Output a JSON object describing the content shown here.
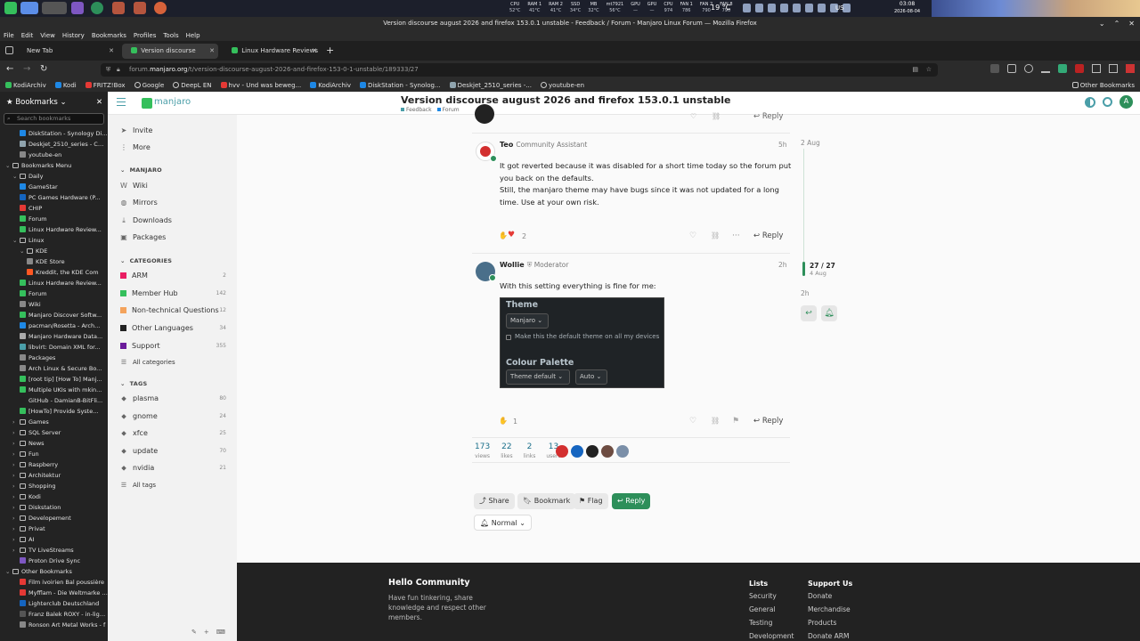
{
  "taskbar": {
    "stats": [
      {
        "label": "CPU",
        "value": "52°C"
      },
      {
        "label": "RAM 1",
        "value": "41°C"
      },
      {
        "label": "RAM 2",
        "value": "41°C"
      },
      {
        "label": "SSD",
        "value": "34°C"
      },
      {
        "label": "MB",
        "value": "32°C"
      },
      {
        "label": "mt7921",
        "value": "56°C"
      },
      {
        "label": "GPU",
        "value": "—"
      },
      {
        "label": "GPU",
        "value": "—"
      },
      {
        "label": "CPU",
        "value": "974"
      },
      {
        "label": "FAN 1",
        "value": "786"
      },
      {
        "label": "FAN 2",
        "value": "790"
      },
      {
        "label": "FAN 8",
        "value": "790"
      }
    ],
    "weather": "19 °C",
    "lang": "US",
    "time": "03:08",
    "date": "2026-08-04"
  },
  "window": {
    "title": "Version discourse august 2026 and firefox 153.0.1 unstable - Feedback / Forum - Manjaro Linux Forum — Mozilla Firefox"
  },
  "menu": [
    "File",
    "Edit",
    "View",
    "History",
    "Bookmarks",
    "Profiles",
    "Tools",
    "Help"
  ],
  "tabs": [
    {
      "label": "New Tab"
    },
    {
      "label": "Version discourse august 2"
    },
    {
      "label": "Linux Hardware Reviews &"
    }
  ],
  "url": {
    "pre": "forum.",
    "domain": "manjaro.org",
    "path": "/t/version-discourse-august-2026-and-firefox-153-0-1-unstable/189333/27"
  },
  "bookmarks_toolbar": {
    "items": [
      "KodiArchiv",
      "Kodi",
      "FRITZ!Box",
      "Google",
      "DeepL EN",
      "hvv - Und was beweg...",
      "KodiArchiv",
      "DiskStation - Synolog...",
      "Deskjet_2510_series -...",
      "youtube-en"
    ],
    "other": "Other Bookmarks"
  },
  "bm_sidebar": {
    "title": "Bookmarks",
    "search_placeholder": "Search bookmarks",
    "rows": [
      {
        "indent": 2,
        "type": "link",
        "label": "DiskStation - Synology Dis...",
        "color": "#1e88e5"
      },
      {
        "indent": 2,
        "type": "link",
        "label": "Deskjet_2510_series - CUP...",
        "color": "#90a4ae"
      },
      {
        "indent": 2,
        "type": "link",
        "label": "youtube-en",
        "color": "#888888"
      },
      {
        "indent": 0,
        "type": "folder",
        "label": "Bookmarks Menu"
      },
      {
        "indent": 1,
        "type": "folder",
        "label": "Daily"
      },
      {
        "indent": 2,
        "type": "link",
        "label": "GameStar",
        "color": "#1e88e5"
      },
      {
        "indent": 2,
        "type": "link",
        "label": "PC Games Hardware (P...",
        "color": "#1565c0"
      },
      {
        "indent": 2,
        "type": "link",
        "label": "CHIP",
        "color": "#e53935"
      },
      {
        "indent": 2,
        "type": "link",
        "label": "Forum",
        "color": "#35bf5c"
      },
      {
        "indent": 2,
        "type": "link",
        "label": "Linux Hardware Review...",
        "color": "#35bf5c"
      },
      {
        "indent": 1,
        "type": "folder",
        "label": "Linux"
      },
      {
        "indent": 2,
        "type": "folder",
        "label": "KDE"
      },
      {
        "indent": 3,
        "type": "link",
        "label": "KDE Store",
        "color": "#888888"
      },
      {
        "indent": 3,
        "type": "link",
        "label": "Kreddit, the KDE Com",
        "color": "#ff5722"
      },
      {
        "indent": 2,
        "type": "link",
        "label": "Linux Hardware Review...",
        "color": "#35bf5c"
      },
      {
        "indent": 2,
        "type": "link",
        "label": "Forum",
        "color": "#35bf5c"
      },
      {
        "indent": 2,
        "type": "link",
        "label": "Wiki",
        "color": "#888888"
      },
      {
        "indent": 2,
        "type": "link",
        "label": "Manjaro Discover Softw...",
        "color": "#35bf5c"
      },
      {
        "indent": 2,
        "type": "link",
        "label": "pacman/Rosetta - Arch...",
        "color": "#1e88e5"
      },
      {
        "indent": 2,
        "type": "link",
        "label": "Manjaro Hardware Data...",
        "color": "#aaaaaa"
      },
      {
        "indent": 2,
        "type": "link",
        "label": "libvirt: Domain XML for...",
        "color": "#4a9ea8"
      },
      {
        "indent": 2,
        "type": "link",
        "label": "Packages",
        "color": "#888888"
      },
      {
        "indent": 2,
        "type": "link",
        "label": "Arch Linux & Secure Bo...",
        "color": "#888888"
      },
      {
        "indent": 2,
        "type": "link",
        "label": "[root tip] [How To] Manj...",
        "color": "#35bf5c"
      },
      {
        "indent": 2,
        "type": "link",
        "label": "Multiple UKIs with mkin...",
        "color": "#35bf5c"
      },
      {
        "indent": 2,
        "type": "link",
        "label": "GitHub - DamianB-BitFli...",
        "color": "#222222"
      },
      {
        "indent": 2,
        "type": "link",
        "label": "[HowTo] Provide Syste...",
        "color": "#35bf5c"
      },
      {
        "indent": 1,
        "type": "folder-closed",
        "label": "Games"
      },
      {
        "indent": 1,
        "type": "folder-closed",
        "label": "SQL Server"
      },
      {
        "indent": 1,
        "type": "folder-closed",
        "label": "News"
      },
      {
        "indent": 1,
        "type": "folder-closed",
        "label": "Fun"
      },
      {
        "indent": 1,
        "type": "folder-closed",
        "label": "Raspberry"
      },
      {
        "indent": 1,
        "type": "folder-closed",
        "label": "Architektur"
      },
      {
        "indent": 1,
        "type": "folder-closed",
        "label": "Shopping"
      },
      {
        "indent": 1,
        "type": "folder-closed",
        "label": "Kodi"
      },
      {
        "indent": 1,
        "type": "folder-closed",
        "label": "Diskstation"
      },
      {
        "indent": 1,
        "type": "folder-closed",
        "label": "Developement"
      },
      {
        "indent": 1,
        "type": "folder-closed",
        "label": "Privat"
      },
      {
        "indent": 1,
        "type": "folder-closed",
        "label": "AI"
      },
      {
        "indent": 1,
        "type": "folder-closed",
        "label": "TV LiveStreams"
      },
      {
        "indent": 2,
        "type": "link",
        "label": "Proton Drive Sync",
        "color": "#7e57c2"
      },
      {
        "indent": 0,
        "type": "folder",
        "label": "Other Bookmarks"
      },
      {
        "indent": 2,
        "type": "link",
        "label": "Film ivoirien Bal poussière",
        "color": "#e53935"
      },
      {
        "indent": 2,
        "type": "link",
        "label": "Myfflam - Die Weltmarke f...",
        "color": "#e53935"
      },
      {
        "indent": 2,
        "type": "link",
        "label": "Lighterclub Deutschland",
        "color": "#1565c0"
      },
      {
        "indent": 2,
        "type": "link",
        "label": "Franz Balek ROXY - in-light...",
        "color": "#555555"
      },
      {
        "indent": 2,
        "type": "link",
        "label": "Ronson Art Metal Works - f",
        "color": "#888888"
      }
    ]
  },
  "discourse_header": {
    "logo": "manjaro",
    "title": "Version discourse august 2026 and firefox 153.0.1 unstable",
    "breadcrumb": [
      "Feedback",
      "Forum"
    ]
  },
  "discourse_sidebar": {
    "top_items": [
      "Invite",
      "More"
    ],
    "manjaro_section": "MANJARO",
    "manjaro_items": [
      "Wiki",
      "Mirrors",
      "Downloads",
      "Packages"
    ],
    "categories_section": "CATEGORIES",
    "categories": [
      {
        "label": "ARM",
        "count": "2",
        "color": "#e91e63"
      },
      {
        "label": "Member Hub",
        "count": "142",
        "color": "#35bf5c"
      },
      {
        "label": "Non-technical Questions",
        "count": "12",
        "color": "#f4a35c"
      },
      {
        "label": "Other Languages",
        "count": "34",
        "color": "#222222"
      },
      {
        "label": "Support",
        "count": "355",
        "color": "#6a1b9a"
      }
    ],
    "all_categories": "All categories",
    "tags_section": "TAGS",
    "tags": [
      {
        "label": "plasma",
        "count": "80"
      },
      {
        "label": "gnome",
        "count": "24"
      },
      {
        "label": "xfce",
        "count": "25"
      },
      {
        "label": "update",
        "count": "70"
      },
      {
        "label": "nvidia",
        "count": "21"
      }
    ],
    "all_tags": "All tags"
  },
  "posts": [
    {
      "author": "Teo",
      "role": "Community Assistant",
      "time": "5h",
      "text": [
        "It got reverted because it was disabled for a short time today so the forum put",
        "you back on the defaults.",
        "Still, the manjaro theme may have bugs since it was not updated for a long",
        "time. Use at your own risk."
      ],
      "likes": "2",
      "reply": "Reply"
    },
    {
      "author": "Wollie",
      "role": "Moderator",
      "time": "2h",
      "text": [
        "With this setting everything is fine for me:"
      ],
      "likes": "1",
      "reply": "Reply"
    }
  ],
  "screenshot_settings": {
    "theme_title": "Theme",
    "theme_value": "Manjaro",
    "default_label": "Make this the default theme on all my devices",
    "palette_title": "Colour Palette",
    "palette_value": "Theme default",
    "auto_value": "Auto"
  },
  "topic_stats": [
    {
      "value": "173",
      "label": "views"
    },
    {
      "value": "22",
      "label": "likes"
    },
    {
      "value": "2",
      "label": "links"
    },
    {
      "value": "13",
      "label": "users"
    }
  ],
  "topic_buttons": {
    "share": "Share",
    "bookmark": "Bookmark",
    "flag": "Flag",
    "reply": "Reply",
    "notification": "Normal"
  },
  "timeline": {
    "start": "2 Aug",
    "position": "27 / 27",
    "position_date": "4 Aug",
    "end": "2h"
  },
  "footer": {
    "title": "Hello Community",
    "tagline": [
      "Have fun tinkering, share",
      "knowledge and respect other",
      "members."
    ],
    "lists_title": "Lists",
    "lists": [
      "Security",
      "General",
      "Testing",
      "Development"
    ],
    "support_title": "Support Us",
    "support": [
      "Donate",
      "Merchandise",
      "Products",
      "Donate ARM"
    ]
  },
  "colors": {
    "accent": "#2d8f5a",
    "manjaro_green": "#35bf5c",
    "link": "#1a6f8a"
  }
}
